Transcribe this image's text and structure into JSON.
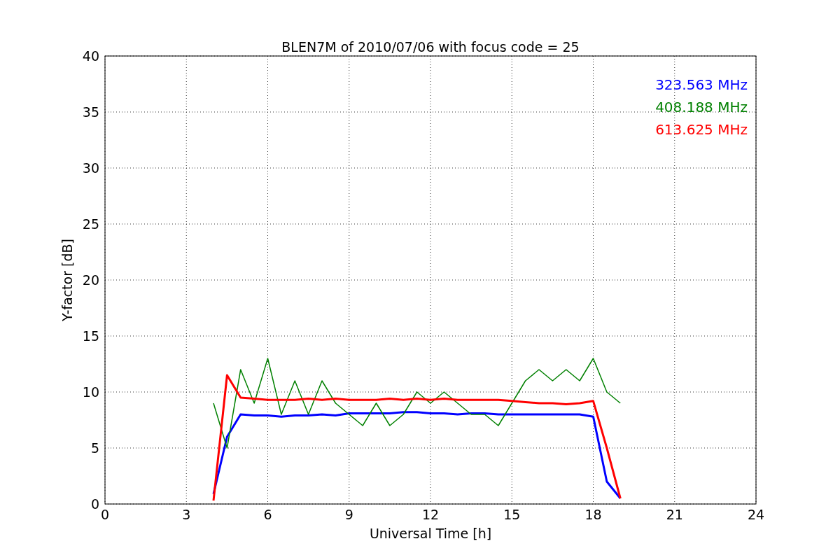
{
  "chart_data": {
    "type": "line",
    "title": "BLEN7M of 2010/07/06 with focus code = 25",
    "xlabel": "Universal Time [h]",
    "ylabel": "Y-factor [dB]",
    "x": [
      4,
      4.5,
      5,
      5.5,
      6,
      6.5,
      7,
      7.5,
      8,
      8.5,
      9,
      9.5,
      10,
      10.5,
      11,
      11.5,
      12,
      12.5,
      13,
      13.5,
      14,
      14.5,
      15,
      15.5,
      16,
      16.5,
      17,
      17.5,
      18,
      18.5,
      19
    ],
    "series": [
      {
        "name": "323.563 MHz",
        "color": "#0000ff",
        "values": [
          0.9,
          6,
          8,
          7.9,
          7.9,
          7.8,
          7.9,
          7.9,
          8,
          7.9,
          8.1,
          8.1,
          8.1,
          8.1,
          8.2,
          8.2,
          8.1,
          8.1,
          8,
          8.1,
          8.1,
          8,
          8,
          8,
          8,
          8,
          8,
          8,
          7.8,
          2,
          0.5
        ]
      },
      {
        "name": "408.188 MHz",
        "color": "#008000",
        "values": [
          9,
          5,
          12,
          9,
          13,
          8,
          11,
          8,
          11,
          9,
          8,
          7,
          9,
          7,
          8,
          10,
          9,
          10,
          9,
          8,
          8,
          7,
          9,
          11,
          12,
          11,
          12,
          11,
          13,
          10,
          9
        ]
      },
      {
        "name": "613.625 MHz",
        "color": "#ff0000",
        "values": [
          0.3,
          11.5,
          9.5,
          9.4,
          9.3,
          9.3,
          9.3,
          9.4,
          9.3,
          9.4,
          9.3,
          9.3,
          9.3,
          9.4,
          9.3,
          9.4,
          9.3,
          9.4,
          9.3,
          9.3,
          9.3,
          9.3,
          9.2,
          9.1,
          9,
          9,
          8.9,
          9,
          9.2,
          5,
          0.5
        ]
      }
    ],
    "xlim": [
      0,
      24
    ],
    "ylim": [
      0,
      40
    ],
    "xticks": [
      0,
      3,
      6,
      9,
      12,
      15,
      18,
      21,
      24
    ],
    "yticks": [
      0,
      5,
      10,
      15,
      20,
      25,
      30,
      35,
      40
    ],
    "grid": true
  }
}
